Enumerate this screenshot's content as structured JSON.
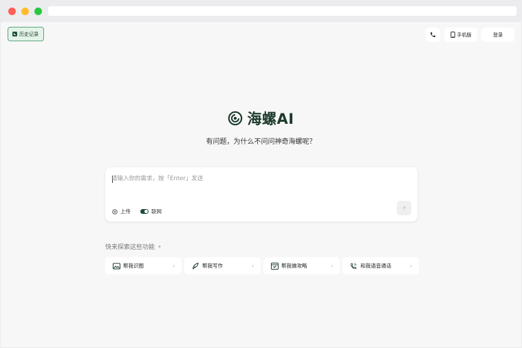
{
  "header": {
    "history_label": "历史记录",
    "mobile_label": "手机版",
    "login_label": "登录"
  },
  "brand": {
    "name": "海螺AI",
    "tagline": "有问题，为什么不问问神奇海螺呢？"
  },
  "composer": {
    "placeholder": "请输入你的需求，按「Enter」发送",
    "upload_label": "上传",
    "web_label": "联网"
  },
  "explore": {
    "title": "快来探索这些功能"
  },
  "features": [
    {
      "label": "帮我识图",
      "icon": "image-icon"
    },
    {
      "label": "帮我写作",
      "icon": "pen-leaf-icon"
    },
    {
      "label": "帮我做攻略",
      "icon": "guide-book-icon"
    },
    {
      "label": "和我语音通话",
      "icon": "phone-call-icon"
    }
  ],
  "colors": {
    "brand_green": "#1d3b2b",
    "history_bg": "#e3f3e8",
    "history_border": "#5aa77e"
  }
}
